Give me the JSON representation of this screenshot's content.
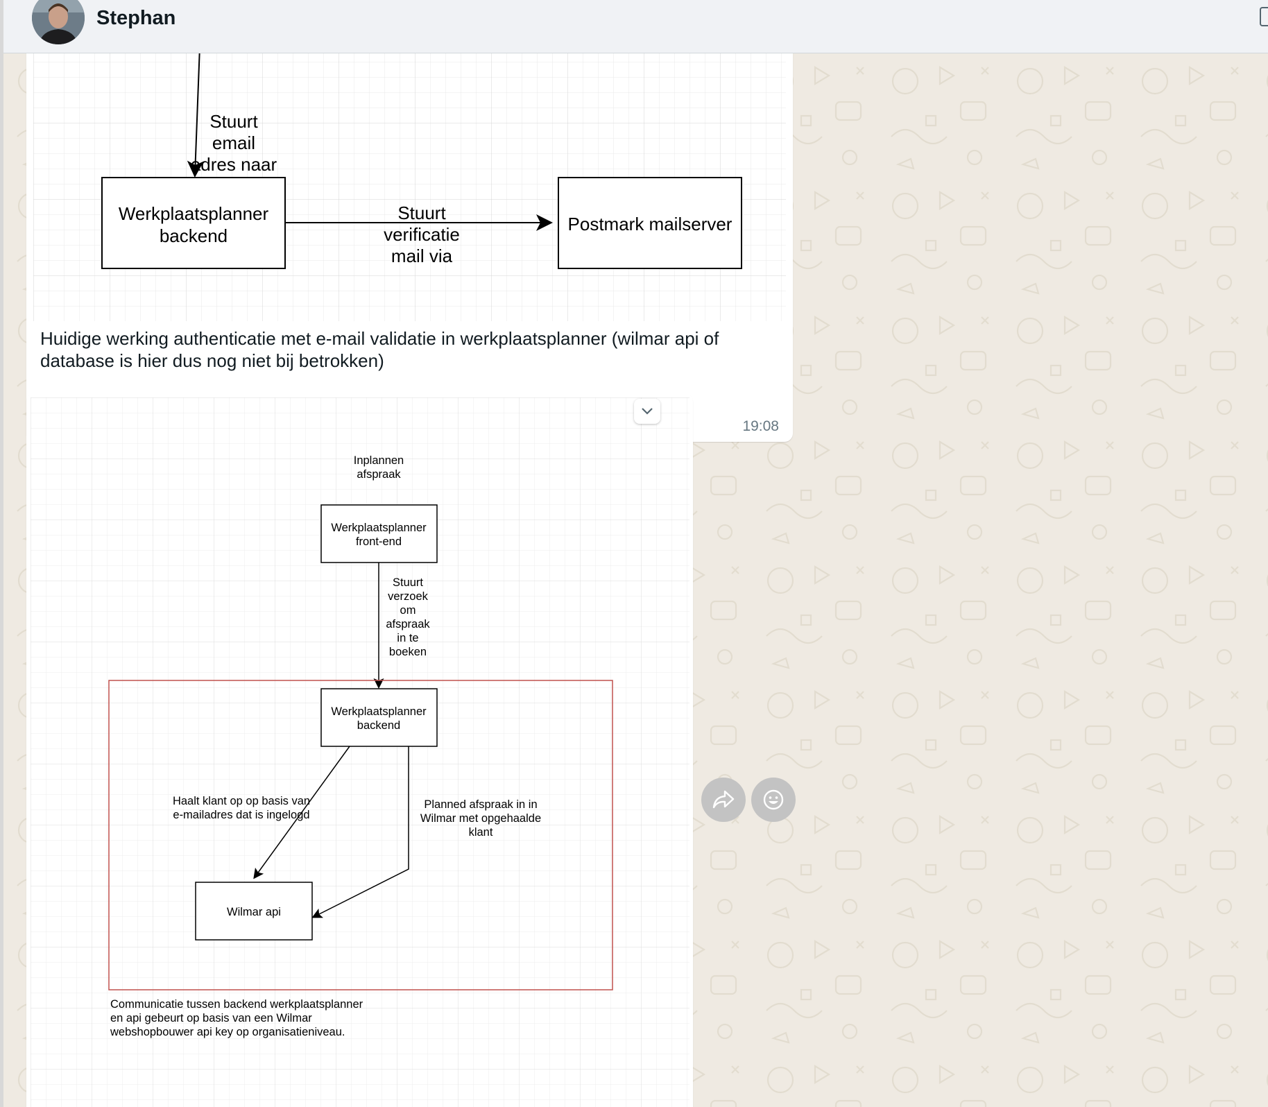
{
  "header": {
    "contact_name": "Stephan",
    "avatar_alt": "contact-avatar"
  },
  "messages": [
    {
      "type": "image-with-caption",
      "diagram": {
        "edge_label_top": [
          "Stuurt",
          "email",
          "adres naar"
        ],
        "node_backend": [
          "Werkplaatsplanner",
          "backend"
        ],
        "edge_label_verify": [
          "Stuurt",
          "verificatie",
          "mail via"
        ],
        "node_mailserver": "Postmark mailserver"
      },
      "caption": "Huidige werking authenticatie met e-mail validatie in werkplaatsplanner (wilmar api of database is hier dus nog niet bij betrokken)",
      "time": "19:08"
    },
    {
      "type": "image",
      "diagram": {
        "start_label": [
          "Inplannen",
          "afspraak"
        ],
        "node_frontend": [
          "Werkplaatsplanner",
          "front-end"
        ],
        "edge_label_request": [
          "Stuurt",
          "verzoek",
          "om",
          "afspraak",
          "in te",
          "boeken"
        ],
        "node_backend": [
          "Werkplaatsplanner",
          "backend"
        ],
        "edge_label_fetch": [
          "Haalt klant op op basis van",
          "e-mailadres dat is ingelogd"
        ],
        "edge_label_plan": [
          "Planned afspraak in in",
          "Wilmar met opgehaalde",
          "klant"
        ],
        "node_wilmar": "Wilmar api",
        "footnote": [
          "Communicatie tussen backend werkplaatsplanner",
          "en api gebeurt op basis van een Wilmar",
          "webshopbouwer api key op organisatieniveau."
        ]
      }
    }
  ],
  "colors": {
    "chat_background": "#efeae2",
    "bubble": "#ffffff",
    "header": "#f0f2f5",
    "boundary_red": "#c0504d"
  },
  "icons": [
    "chevron-down-icon",
    "forward-icon",
    "emoji-icon"
  ]
}
